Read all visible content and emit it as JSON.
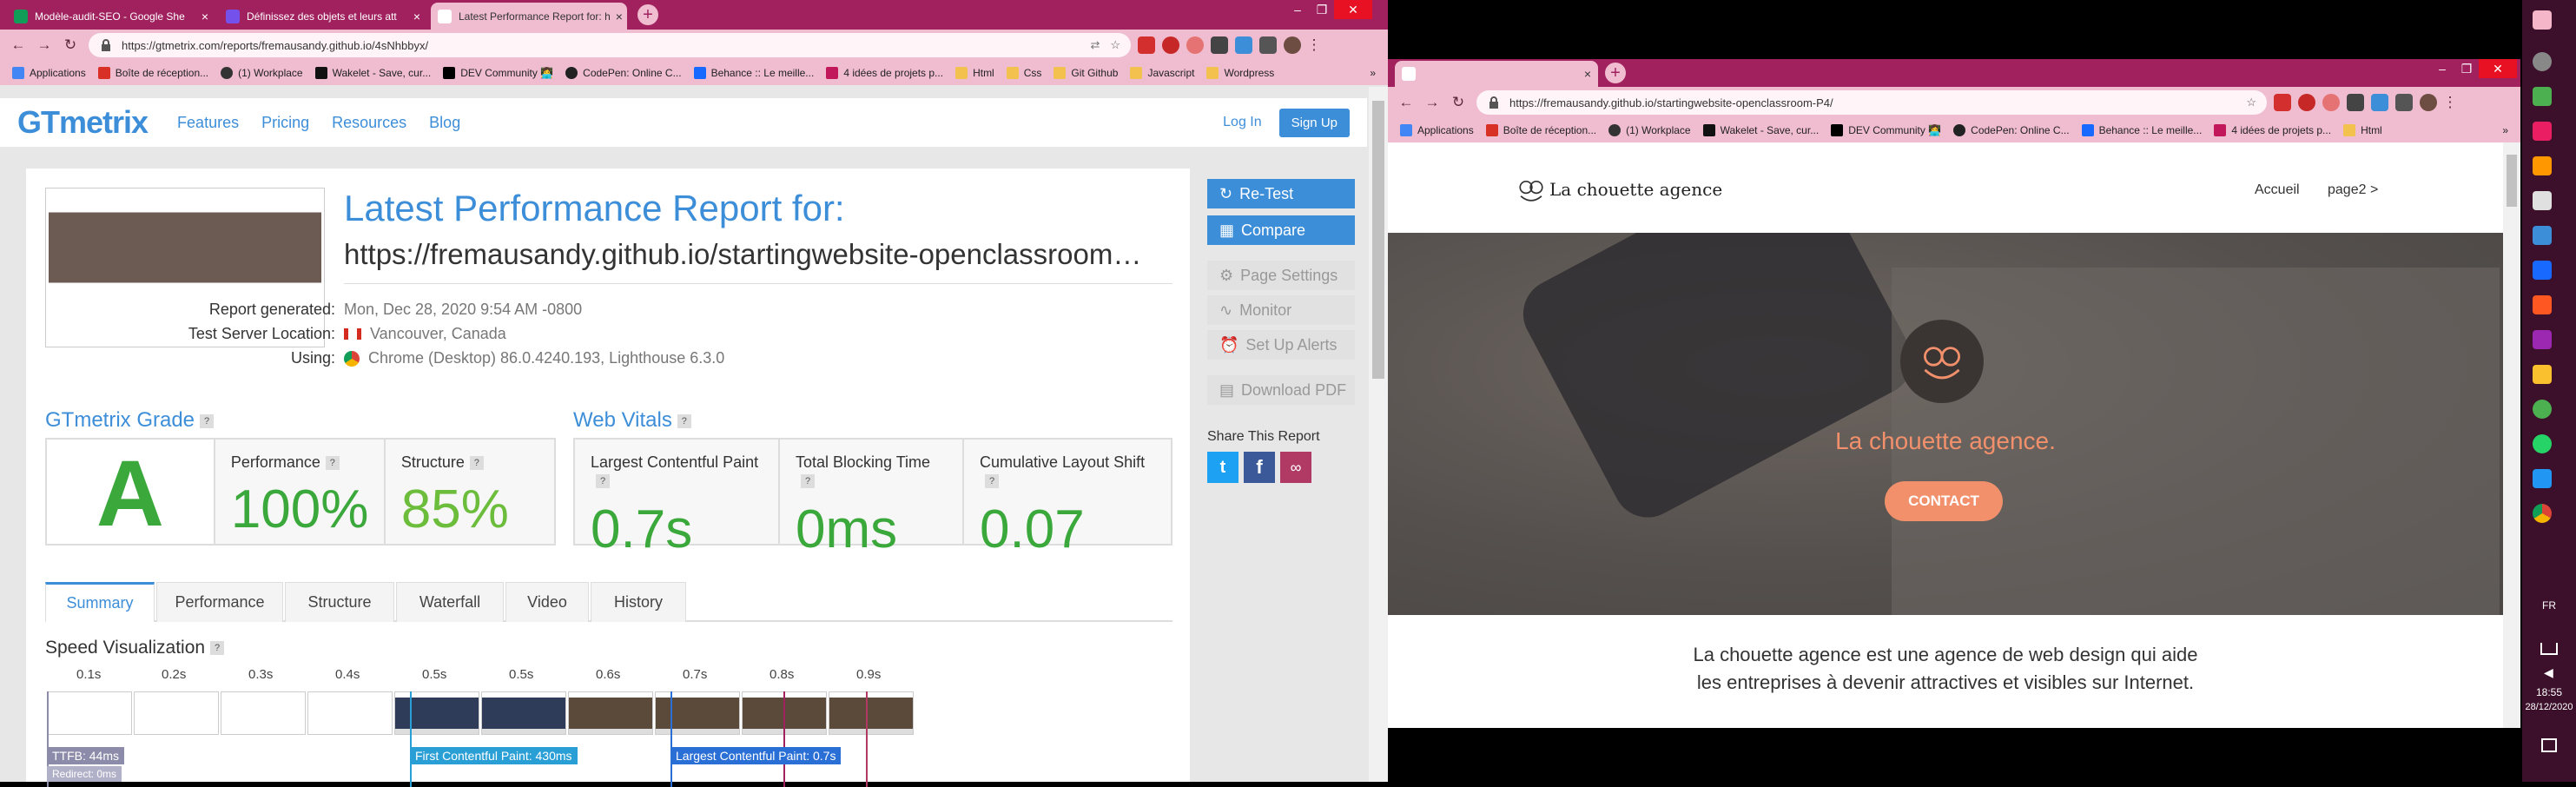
{
  "left_window": {
    "tabs": [
      {
        "title": "Modèle-audit-SEO - Google She",
        "favicon_color": "#0f9d58"
      },
      {
        "title": "Définissez des objets et leurs att",
        "favicon_color": "#7451eb"
      },
      {
        "title": "Latest Performance Report for: h",
        "favicon_color": "#f0bccf"
      }
    ],
    "url": "https://gtmetrix.com/reports/fremausandy.github.io/4sNhbbyx/",
    "bookmarks": [
      "Applications",
      "Boîte de réception...",
      "(1) Workplace",
      "Wakelet - Save, cur...",
      "DEV Community 👩‍💻",
      "CodePen: Online C...",
      "Behance :: Le meille...",
      "4 idées de projets p...",
      "Html",
      "Css",
      "Git Github",
      "Javascript",
      "Wordpress"
    ],
    "bookmarks_more": "»"
  },
  "gtmetrix": {
    "logo": "GTmetrix",
    "nav": [
      "Features",
      "Pricing",
      "Resources",
      "Blog"
    ],
    "login": "Log In",
    "signup": "Sign Up",
    "title": "Latest Performance Report for:",
    "report_url": "https://fremausandy.github.io/startingwebsite-openclassroom…",
    "details": [
      {
        "label": "Report generated:",
        "value": "Mon, Dec 28, 2020 9:54 AM -0800"
      },
      {
        "label": "Test Server Location:",
        "value": "Vancouver, Canada"
      },
      {
        "label": "Using:",
        "value": "Chrome (Desktop) 86.0.4240.193, Lighthouse 6.3.0"
      }
    ],
    "grade_title": "GTmetrix Grade",
    "grade": "A",
    "performance_label": "Performance",
    "performance_value": "100%",
    "structure_label": "Structure",
    "structure_value": "85%",
    "vitals_title": "Web Vitals",
    "vitals": [
      {
        "label": "Largest Contentful Paint",
        "value": "0.7s"
      },
      {
        "label": "Total Blocking Time",
        "value": "0ms"
      },
      {
        "label": "Cumulative Layout Shift",
        "value": "0.07"
      }
    ],
    "actions": {
      "retest": "Re-Test",
      "compare": "Compare",
      "page_settings": "Page Settings",
      "monitor": "Monitor",
      "alerts": "Set Up Alerts",
      "pdf": "Download PDF"
    },
    "share_title": "Share This Report",
    "share_colors": {
      "twitter": "#1da1f2",
      "facebook": "#3b5998",
      "link": "#b03a64"
    },
    "tabs": [
      "Summary",
      "Performance",
      "Structure",
      "Waterfall",
      "Video",
      "History"
    ],
    "speed_title": "Speed Visualization",
    "ticks": [
      "0.1s",
      "0.2s",
      "0.3s",
      "0.4s",
      "0.5s",
      "0.6s",
      "0.7s",
      "0.8s",
      "0.9s"
    ],
    "extra_tick": "0.5s",
    "markers": {
      "ttfb": "TTFB: 44ms",
      "redirect": "Redirect: 0ms",
      "fcp": "First Contentful Paint: 430ms",
      "lcp": "Largest Contentful Paint: 0.7s"
    }
  },
  "right_window": {
    "url": "https://fremausandy.github.io/startingwebsite-openclassroom-P4/",
    "bookmarks": [
      "Applications",
      "Boîte de réception...",
      "(1) Workplace",
      "Wakelet - Save, cur...",
      "DEV Community 👩‍💻",
      "CodePen: Online C...",
      "Behance :: Le meille...",
      "4 idées de projets p...",
      "Html"
    ],
    "bookmarks_more": "»"
  },
  "site": {
    "brand": "La chouette agence",
    "nav": [
      "Accueil",
      "page2 >"
    ],
    "hero_title": "La chouette agence.",
    "cta": "CONTACT",
    "intro_line1": "La chouette agence est une agence de web design qui aide",
    "intro_line2": "les entreprises à devenir attractives et visibles sur Internet.",
    "accent": "#f1906b"
  },
  "taskbar": {
    "lang": "FR",
    "time": "18:55",
    "date": "28/12/2020"
  }
}
